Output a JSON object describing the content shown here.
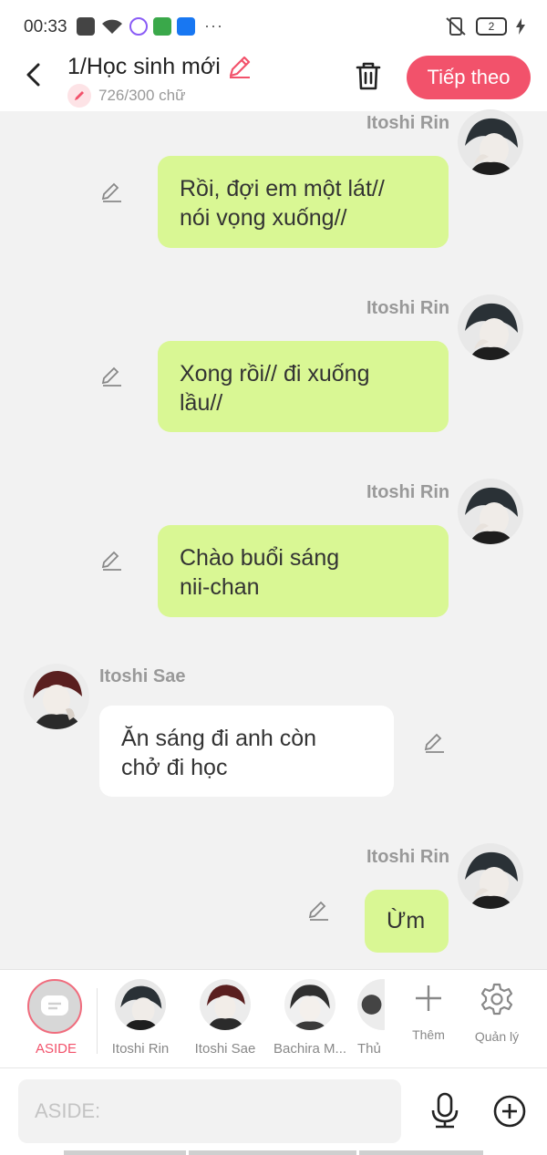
{
  "status_bar": {
    "time": "00:33",
    "battery": "2"
  },
  "header": {
    "title": "1/Học sinh mới",
    "word_count": "726/300 chữ",
    "next_label": "Tiếp theo"
  },
  "messages": [
    {
      "sender": "Itoshi Rin",
      "text_line1": "Rồi, đợi em một lát//",
      "text_line2": "nói vọng xuống//",
      "side": "right"
    },
    {
      "sender": "Itoshi Rin",
      "text_line1": "Xong rồi// đi xuống",
      "text_line2": "lầu//",
      "side": "right"
    },
    {
      "sender": "Itoshi Rin",
      "text_line1": "Chào buổi sáng",
      "text_line2": "nii-chan",
      "side": "right"
    },
    {
      "sender": "Itoshi Sae",
      "text_line1": "Ăn sáng đi anh còn",
      "text_line2": "chở đi học",
      "side": "left"
    },
    {
      "sender": "Itoshi Rin",
      "text_line1": "Ừm",
      "side": "right"
    }
  ],
  "characters": {
    "aside_label": "ASIDE",
    "items": [
      {
        "name": "Itoshi Rin"
      },
      {
        "name": "Itoshi Sae"
      },
      {
        "name": "Bachira M..."
      },
      {
        "name": "Thủ"
      }
    ],
    "add_label": "Thêm",
    "manage_label": "Quản lý"
  },
  "composer": {
    "placeholder": "ASIDE:"
  },
  "colors": {
    "accent": "#f2526b",
    "bubble_self": "#d9f794",
    "bubble_other": "#ffffff"
  }
}
